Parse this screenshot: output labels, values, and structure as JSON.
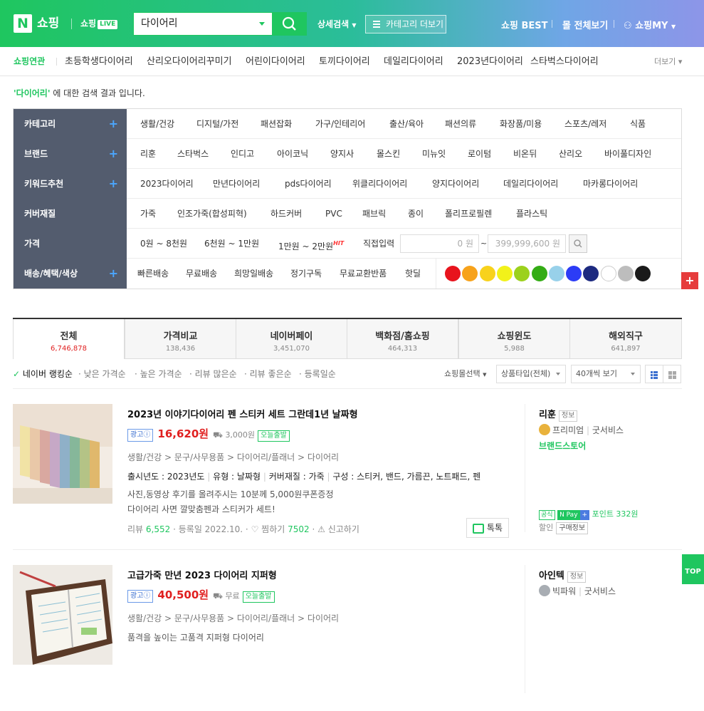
{
  "header": {
    "logo_letter": "N",
    "logo_text": "쇼핑",
    "live_label": "쇼핑",
    "live_badge": "LIVE",
    "search_value": "다이어리",
    "detail_search": "상세검색",
    "category_more": "카테고리 더보기",
    "best": "쇼핑 BEST",
    "mall_all": "몰 전체보기",
    "my": "쇼핑MY"
  },
  "related": {
    "label": "쇼핑연관",
    "keywords": [
      "초등학생다이어리",
      "산리오다이어리꾸미기",
      "어린이다이어리",
      "토끼다이어리",
      "데일리다이어리",
      "2023년다이어리",
      "스타벅스다이어리"
    ],
    "more": "더보기"
  },
  "result_text": {
    "keyword": "'다이어리'",
    "suffix": " 에 대한 검색 결과 입니다."
  },
  "filters": {
    "category": {
      "label": "카테고리",
      "items": [
        "생활/건강",
        "디지털/가전",
        "패션잡화",
        "가구/인테리어",
        "출산/육아",
        "패션의류",
        "화장품/미용",
        "스포츠/레저",
        "식품"
      ]
    },
    "brand": {
      "label": "브랜드",
      "items": [
        "리훈",
        "스타벅스",
        "인디고",
        "아이코닉",
        "양지사",
        "몰스킨",
        "미뉴잇",
        "로이텀",
        "비온뒤",
        "산리오",
        "바이풀디자인"
      ]
    },
    "keyword": {
      "label": "키워드추천",
      "items": [
        "2023다이어리",
        "만년다이어리",
        "pds다이어리",
        "위클리다이어리",
        "양지다이어리",
        "데일리다이어리",
        "마카롱다이어리"
      ]
    },
    "cover": {
      "label": "커버재질",
      "items": [
        "가죽",
        "인조가죽(합성피혁)",
        "하드커버",
        "PVC",
        "패브릭",
        "종이",
        "폴리프로필렌",
        "플라스틱"
      ]
    },
    "price": {
      "label": "가격",
      "items": [
        "0원 ~ 8천원",
        "6천원 ~ 1만원",
        "1만원 ~ 2만원"
      ],
      "hit": "HIT",
      "direct": "직접입력",
      "min_value": "0",
      "max_value": "399,999,600",
      "unit": "원",
      "tilde": "~"
    },
    "delivery": {
      "label": "배송/혜택/색상",
      "items": [
        "빠른배송",
        "무료배송",
        "희망일배송",
        "정기구독",
        "무료교환반품",
        "핫딜"
      ],
      "colors": [
        "#e8141d",
        "#f7a21b",
        "#f8d21c",
        "#f2f21a",
        "#9cd11c",
        "#34ac15",
        "#98d1ea",
        "#2c3cf6",
        "#1d2a80",
        "#ffffff",
        "#bdbdbd",
        "#1a1a1a"
      ]
    }
  },
  "tabs": [
    {
      "label": "전체",
      "count": "6,746,878"
    },
    {
      "label": "가격비교",
      "count": "138,436"
    },
    {
      "label": "네이버페이",
      "count": "3,451,070"
    },
    {
      "label": "백화점/홈쇼핑",
      "count": "464,313"
    },
    {
      "label": "쇼핑윈도",
      "count": "5,988"
    },
    {
      "label": "해외직구",
      "count": "641,897"
    }
  ],
  "sort": {
    "items": [
      "네이버 랭킹순",
      "낮은 가격순",
      "높은 가격순",
      "리뷰 많은순",
      "리뷰 좋은순",
      "등록일순"
    ],
    "mall_select": "쇼핑몰선택",
    "type_select": "상품타입(전체)",
    "view_select": "40개씩 보기"
  },
  "products": [
    {
      "title": "2023년 이야기다이어리 펜 스티커 세트 그란데1년 날짜형",
      "ad": "광고",
      "price": "16,620원",
      "ship": "3,000원",
      "today": "오늘출발",
      "category": [
        "생활/건강",
        "문구/사무용품",
        "다이어리/플래너",
        "다이어리"
      ],
      "spec": [
        "출시년도 : 2023년도",
        "유형 : 날짜형",
        "커버재질 : 가죽",
        "구성 : 스티커, 밴드, 가름끈, 노트패드, 펜"
      ],
      "desc": [
        "사진,동영상 후기를 올려주시는 10분께 5,000원쿠폰증정",
        "다이어리 사면 깔맞춤펜과 스티커가 세트!"
      ],
      "review_label": "리뷰",
      "review": "6,552",
      "reg": "등록일 2022.10.",
      "zzim": "찜하기",
      "zzim_count": "7502",
      "report": "신고하기",
      "talk": "톡톡",
      "mall": "리훈",
      "info": "정보",
      "grade": "프리미엄",
      "service": "굿서비스",
      "brand_store": "브랜드스토어",
      "official": "공식",
      "npay": "N Pay",
      "point": "포인트 332원",
      "discount": "할인",
      "buy_info": "구매정보"
    },
    {
      "title": "고급가죽 만년 2023 다이어리 지퍼형",
      "ad": "광고",
      "price": "40,500원",
      "ship": "무료",
      "today": "오늘출발",
      "category": [
        "생활/건강",
        "문구/사무용품",
        "다이어리/플래너",
        "다이어리"
      ],
      "desc": [
        "품격을 높이는 고품격 지퍼형 다이어리"
      ],
      "mall": "아인텍",
      "info": "정보",
      "grade": "빅파워",
      "service": "굿서비스"
    }
  ],
  "side": {
    "plus": "+",
    "top": "TOP"
  }
}
